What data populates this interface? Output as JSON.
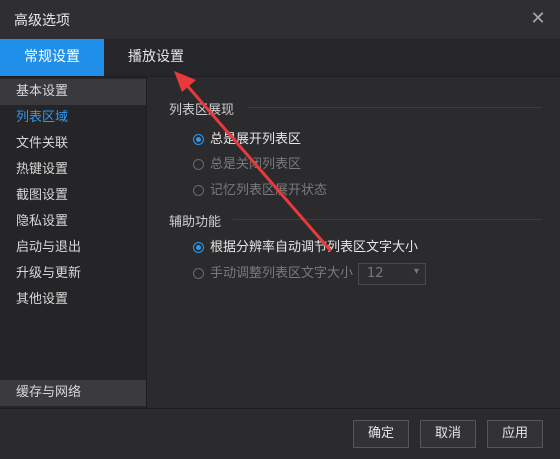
{
  "window": {
    "title": "高级选项",
    "close_icon": "close-icon"
  },
  "tabs": [
    {
      "label": "常规设置",
      "active": true
    },
    {
      "label": "播放设置",
      "active": false
    }
  ],
  "sidebar": {
    "items": [
      {
        "label": "基本设置"
      },
      {
        "label": "列表区域"
      },
      {
        "label": "文件关联"
      },
      {
        "label": "热键设置"
      },
      {
        "label": "截图设置"
      },
      {
        "label": "隐私设置"
      },
      {
        "label": "启动与退出"
      },
      {
        "label": "升级与更新"
      },
      {
        "label": "其他设置"
      }
    ],
    "bottom_item": {
      "label": "缓存与网络"
    }
  },
  "main": {
    "list_display": {
      "title": "列表区展现",
      "options": [
        {
          "label": "总是展开列表区",
          "checked": true
        },
        {
          "label": "总是关闭列表区",
          "checked": false
        },
        {
          "label": "记忆列表区展开状态",
          "checked": false
        }
      ]
    },
    "assist": {
      "title": "辅助功能",
      "options": [
        {
          "label": "根据分辨率自动调节列表区文字大小",
          "checked": true
        },
        {
          "label": "手动调整列表区文字大小",
          "checked": false
        }
      ],
      "font_size_select": "12"
    }
  },
  "footer": {
    "ok": "确定",
    "cancel": "取消",
    "apply": "应用"
  },
  "colors": {
    "accent": "#1f8fea",
    "annotation_arrow": "#e8393c"
  }
}
